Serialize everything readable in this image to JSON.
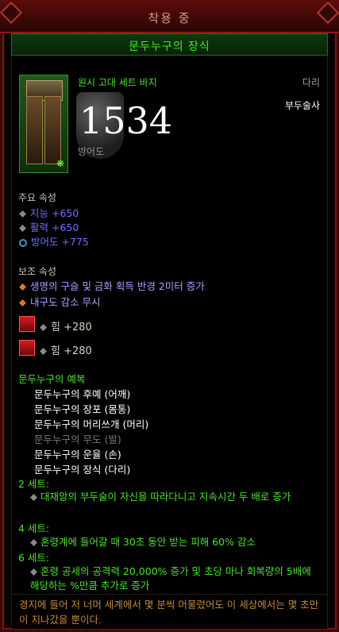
{
  "header": {
    "title": "착용 중"
  },
  "item": {
    "name": "문두누구의 장식",
    "type": "원시 고대 세트 바지",
    "slot": "다리",
    "class_restriction": "부두술사",
    "armor_value": "1534",
    "armor_label": "방어도",
    "icon": "pants-icon",
    "name_color": "#4be32b"
  },
  "primary": {
    "label": "주요 속성",
    "stats": [
      "지능 +650",
      "활력 +650",
      "방어도 +775"
    ]
  },
  "secondary": {
    "label": "보조 속성",
    "stats": [
      "생명의 구슬 및 금화 획득 반경 2미터 증가",
      "내구도 감소 무시"
    ]
  },
  "sockets": [
    {
      "stat": "힘 +280",
      "icon": "ruby-gem-icon"
    },
    {
      "stat": "힘 +280",
      "icon": "ruby-gem-icon"
    }
  ],
  "set": {
    "title": "문두누구의 예복",
    "pieces": [
      "문두누구의 후예 (어깨)",
      "문두누구의 장포 (몸통)",
      "문두누구의 머리쓰개 (머리)",
      "문두누구의 무도 (발)",
      "문두누구의 운율 (손)",
      "문두누구의 장식 (다리)"
    ],
    "bonuses": [
      {
        "label": "2 세트:",
        "text": "대재앙의 부두술이 자신을 따라다니고 지속시간 두 배로 증가"
      },
      {
        "label": "4 세트:",
        "text": "혼령계에 들어갈 때 30초 동안 받는 피해 60% 감소"
      },
      {
        "label": "6 세트:",
        "text": "혼령 공세의 공격력 20,000% 증가 및 초당 마나 회복량의 5배에 해당하는 %만큼 추가로 증가"
      }
    ]
  },
  "flavor": "경지에 들어 저 너머 세계에서 몇 분씩 머물렀어도 이 세상에서는 몇 초만이 지나갔을 뿐이다."
}
